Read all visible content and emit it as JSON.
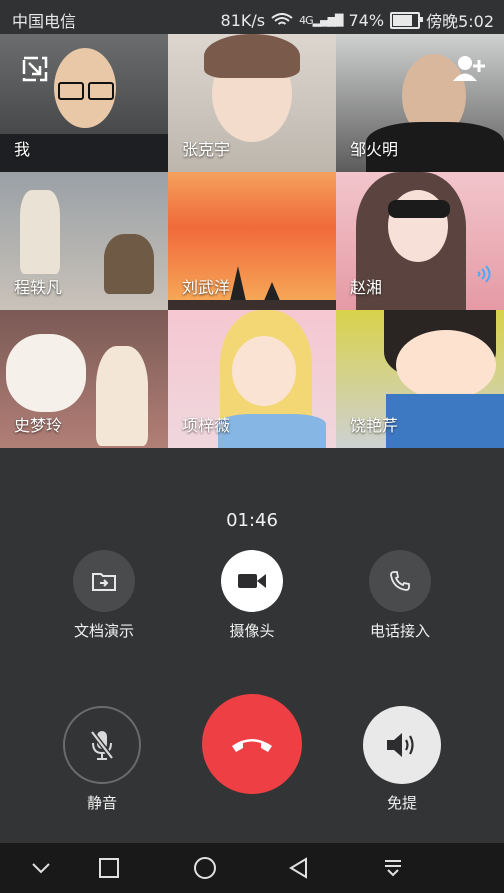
{
  "status": {
    "carrier": "中国电信",
    "speed": "81K/s",
    "network": "4G",
    "battery_percent": "74%",
    "battery_level": 0.74,
    "time": "傍晚5:02"
  },
  "participants": [
    {
      "name": "我"
    },
    {
      "name": "张克宇"
    },
    {
      "name": "邹火明"
    },
    {
      "name": "程轶凡"
    },
    {
      "name": "刘武洋"
    },
    {
      "name": "赵湘"
    },
    {
      "name": "史梦玲"
    },
    {
      "name": "项梓薇"
    },
    {
      "name": "饶艳芹"
    }
  ],
  "call": {
    "timer": "01:46",
    "doc_share_label": "文档演示",
    "camera_label": "摄像头",
    "phone_join_label": "电话接入",
    "mute_label": "静音",
    "speaker_label": "免提"
  },
  "colors": {
    "accent_red": "#ee3f45",
    "panel_bg": "#333436",
    "button_dark": "#4a4b4d"
  },
  "icons": {
    "minimize": "minimize-window-icon",
    "add_user": "add-user-icon",
    "speaking": "speaking-indicator-icon",
    "doc_share": "folder-share-icon",
    "camera": "video-camera-icon",
    "phone": "phone-icon",
    "mic_off": "mic-off-icon",
    "hang_up": "hang-up-icon",
    "speaker": "speaker-icon"
  }
}
